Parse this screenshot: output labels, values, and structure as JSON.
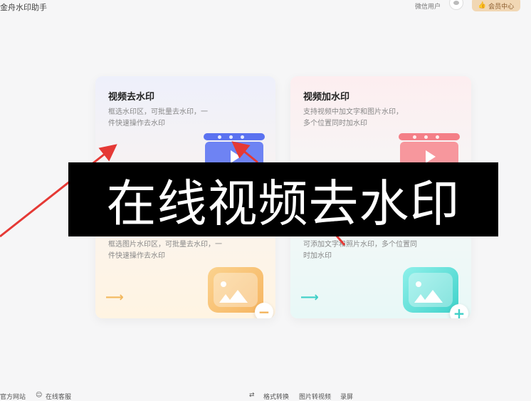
{
  "app": {
    "title": "金舟水印助手"
  },
  "header": {
    "user_name": "微信用户",
    "vip_label": "会员中心"
  },
  "cards": [
    {
      "title": "视频去水印",
      "description": "框选水印区，可批量去水印，一件快速操作去水印",
      "accent": "#5b72f0"
    },
    {
      "title": "视频加水印",
      "description": "支持视频中加文字和图片水印，多个位置同时加水印",
      "accent": "#f47f87"
    },
    {
      "description": "框选图片水印区，可批量去水印，一件快速操作去水印",
      "accent": "#f6c073",
      "badge": "−"
    },
    {
      "description": "可添加文字和照片水印，多个位置同时加水印",
      "accent": "#4fd6cf",
      "badge": "+"
    }
  ],
  "overlay": {
    "text": "在线视频去水印"
  },
  "footer": {
    "items": [
      "官方网站",
      "在线客服",
      "格式转换",
      "图片转视频",
      "录屏"
    ]
  },
  "colors": {
    "annotation_arrow": "#e53935"
  }
}
